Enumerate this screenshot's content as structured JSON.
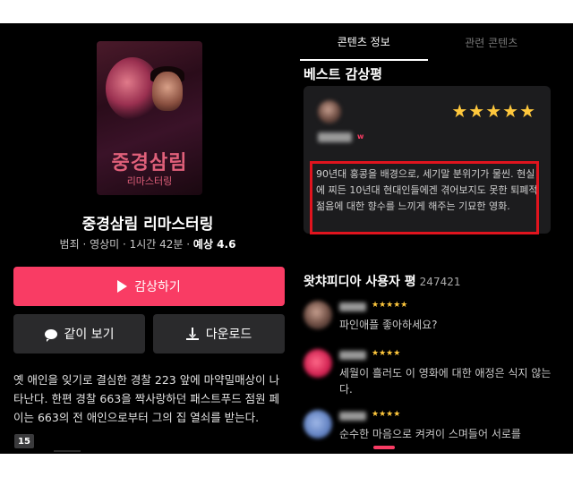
{
  "poster": {
    "title_art": "중경삼림",
    "subtitle_art": "리마스터링"
  },
  "movie": {
    "title": "중경삼림 리마스터링",
    "meta": "범죄 · 영상미 · 1시간 42분 · ",
    "rating_label": "예상 4.6",
    "synopsis": "옛 애인을 잊기로 결심한 경찰 223 앞에 마약밀매상이 나타난다. 한편 경찰 663을 짝사랑하던 패스트푸드 점원 페이는 663의 전 애인으로부터 그의 집 열쇠를 받는다.",
    "age_rating": "15"
  },
  "actions": {
    "watch_label": "감상하기",
    "together_label": "같이 보기",
    "download_label": "다운로드"
  },
  "tabs": [
    {
      "label": "콘텐츠 정보",
      "active": true
    },
    {
      "label": "관련 콘텐츠",
      "active": false
    }
  ],
  "best_review": {
    "section_title": "베스트 감상평",
    "stars": "★★★★★",
    "badge": "w",
    "text": "90년대 홍콩을 배경으로, 세기말 분위기가 물씬. 현실에 찌든 10년대 현대인들에겐 겪어보지도 못한 퇴폐적 젊음에 대한 향수를 느끼게 해주는 기묘한 영화."
  },
  "user_reviews": {
    "section_title": "왓챠피디아 사용자 평",
    "count": "247421",
    "items": [
      {
        "stars": "★★★★★",
        "text": "파인애플 좋아하세요?"
      },
      {
        "stars": "★★★★",
        "text": "세월이 흘러도 이 영화에 대한 애정은 식지 않는다."
      },
      {
        "stars": "★★★★",
        "text": "순수한 마음으로 켜켜이 스며들어 서로를"
      }
    ]
  },
  "colors": {
    "accent": "#f93c64",
    "star": "#ffc83d",
    "highlight_border": "#e0141e"
  }
}
